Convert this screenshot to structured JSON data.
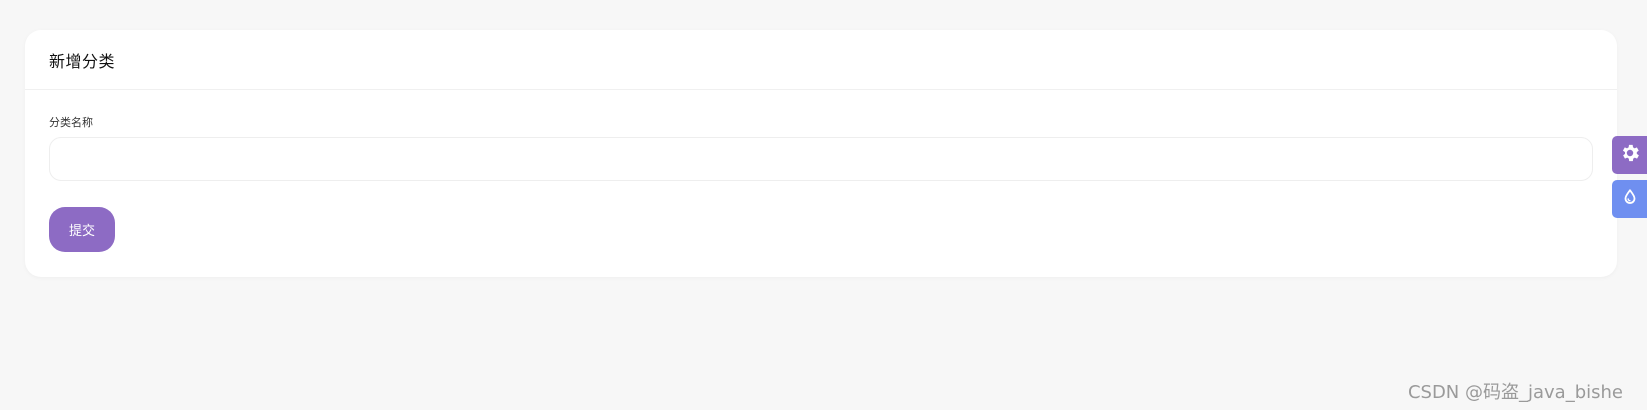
{
  "page": {
    "title": "新增分类"
  },
  "form": {
    "field_label": "分类名称",
    "field_value": "",
    "field_placeholder": "",
    "submit_label": "提交"
  },
  "side_tools": [
    {
      "icon": "gear-icon",
      "color": "#8d6bc4"
    },
    {
      "icon": "droplet-icon",
      "color": "#6f8ff0"
    }
  ],
  "watermark": "CSDN @码盗_java_bishe",
  "colors": {
    "accent": "#8d6bc4",
    "theme_tool": "#6f8ff0",
    "background": "#f7f7f7",
    "card": "#ffffff"
  }
}
